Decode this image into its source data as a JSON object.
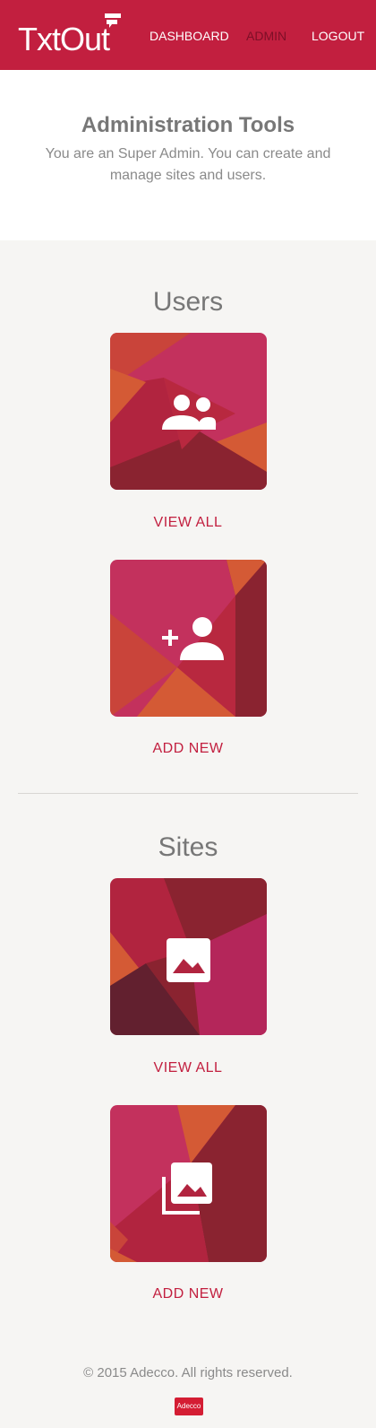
{
  "app": {
    "brand": "TxtOut"
  },
  "nav": {
    "dashboard": "DASHBOARD",
    "admin": "ADMIN",
    "logout": "LOGOUT"
  },
  "hero": {
    "title": "Administration Tools",
    "subtitle": "You are an Super Admin. You can create and manage sites and users."
  },
  "users": {
    "title": "Users",
    "view_all": "VIEW ALL",
    "add_new": "ADD NEW"
  },
  "sites": {
    "title": "Sites",
    "view_all": "VIEW ALL",
    "add_new": "ADD NEW"
  },
  "footer": {
    "copyright": "© 2015 Adecco. All rights reserved.",
    "logo_text": "Adecco"
  },
  "colors": {
    "brand": "#c21f3f",
    "tile_pink": "#c3315d",
    "tile_orange": "#d45a35",
    "tile_crimson": "#b1243f",
    "tile_dark": "#8a2330"
  },
  "icons": [
    "users-icon",
    "add-user-icon",
    "image-icon",
    "image-library-icon"
  ]
}
